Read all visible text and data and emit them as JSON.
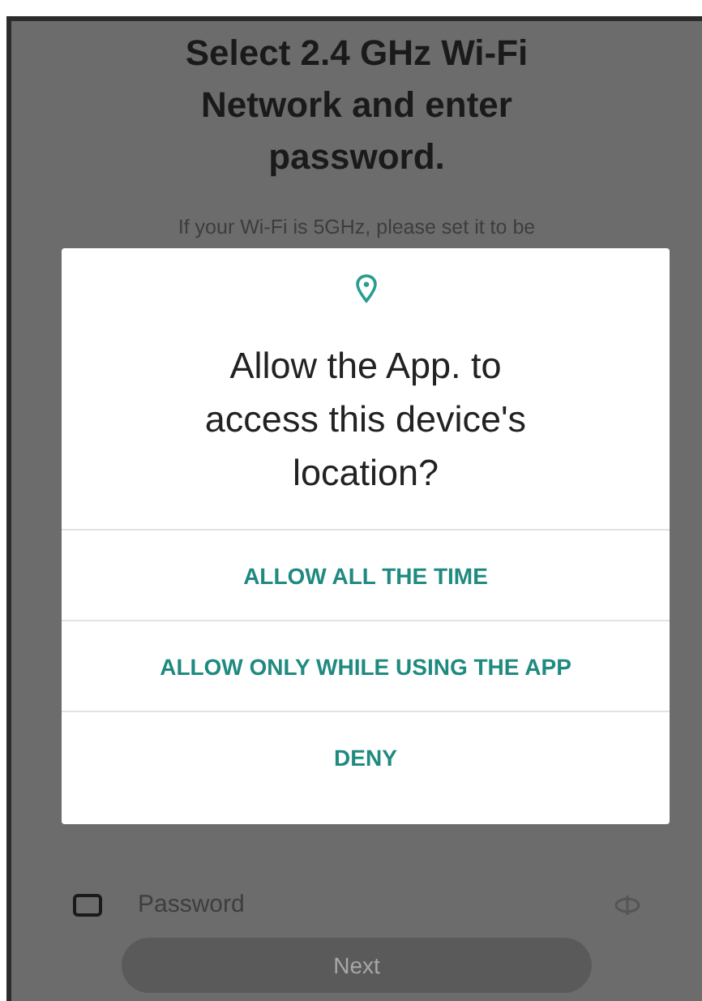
{
  "screen": {
    "title": "Select 2.4 GHz Wi-Fi Network and enter password.",
    "subtitle": "If your Wi-Fi is 5GHz, please set it to be",
    "password_field": {
      "placeholder": "Password"
    },
    "next_button": "Next"
  },
  "dialog": {
    "message": "Allow the App. to access this device's location?",
    "buttons": [
      "ALLOW ALL THE TIME",
      "ALLOW ONLY WHILE USING THE APP",
      "DENY"
    ]
  }
}
